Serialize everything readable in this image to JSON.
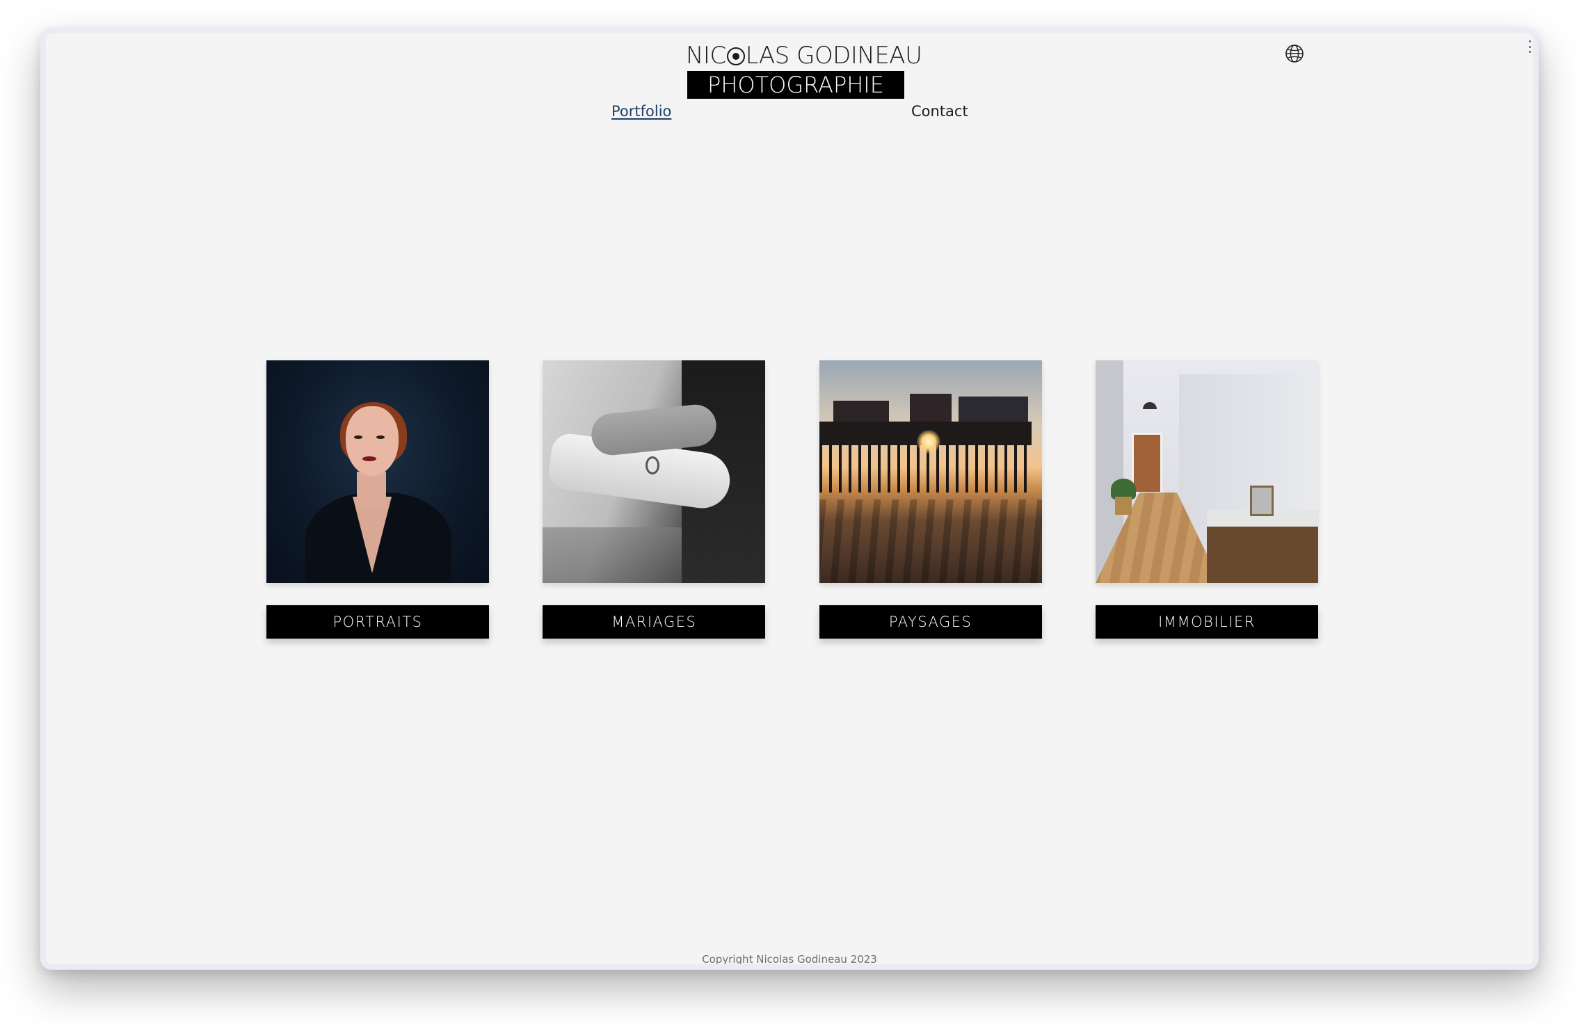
{
  "header": {
    "logo_top": "NIC",
    "logo_top_rest": "LAS GODINEAU",
    "logo_bottom": "PHOTOGRAPHIE",
    "language_icon": "globe-icon"
  },
  "nav": {
    "portfolio": "Portfolio",
    "contact": "Contact"
  },
  "gallery": [
    {
      "label": "PORTRAITS",
      "image": "portrait-photo"
    },
    {
      "label": "MARIAGES",
      "image": "wedding-rings-photo"
    },
    {
      "label": "PAYSAGES",
      "image": "pier-sunset-photo"
    },
    {
      "label": "IMMOBILIER",
      "image": "hallway-interior-photo"
    }
  ],
  "footer": {
    "copyright": "Copyright Nicolas Godineau 2023"
  },
  "colors": {
    "background": "#f4f4f4",
    "button": "#000000",
    "button_text": "#ffffff",
    "active_link": "#1f3f66"
  }
}
